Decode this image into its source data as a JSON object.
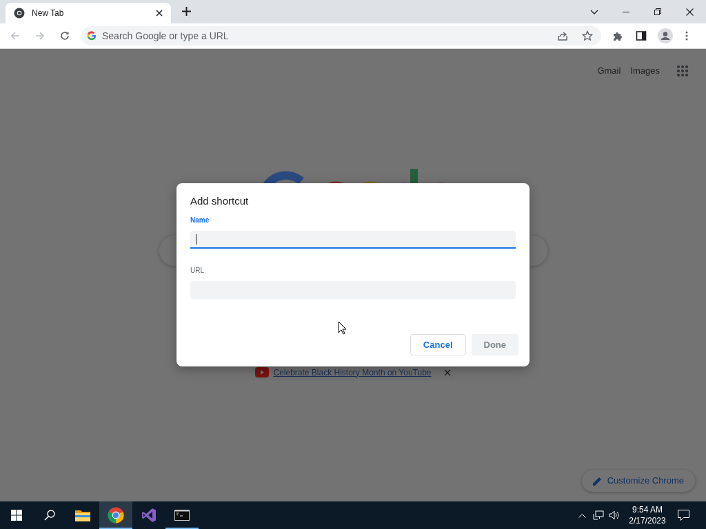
{
  "browser": {
    "tabs": [
      {
        "title": "New Tab",
        "selected": true
      }
    ],
    "omnibox": {
      "placeholder": "Search Google or type a URL"
    }
  },
  "page": {
    "links": [
      "Gmail",
      "Images"
    ],
    "promo": {
      "text": "Celebrate Black History Month on YouTube"
    },
    "customize_button": "Customize Chrome"
  },
  "dialog": {
    "title": "Add shortcut",
    "fields": [
      {
        "label": "Name",
        "focused": true
      },
      {
        "label": "URL",
        "focused": false
      }
    ],
    "buttons": [
      {
        "label": "Cancel",
        "disabled": false
      },
      {
        "label": "Done",
        "disabled": true
      }
    ]
  },
  "taskbar": {
    "apps": [
      {
        "kind": "explorer",
        "selected": false,
        "running": false
      },
      {
        "kind": "chrome",
        "selected": true,
        "running": true
      },
      {
        "kind": "vs",
        "selected": false,
        "running": false
      },
      {
        "kind": "terminal",
        "selected": false,
        "running": true
      }
    ],
    "time": "9:54 AM",
    "date": "2/17/2023"
  }
}
